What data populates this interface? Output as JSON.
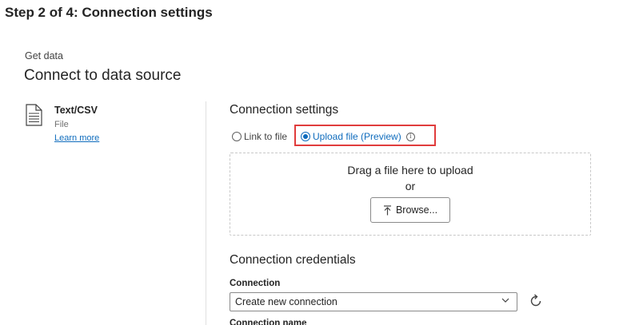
{
  "step_title": "Step 2 of 4: Connection settings",
  "breadcrumb": "Get data",
  "page_heading": "Connect to data source",
  "connector": {
    "name": "Text/CSV",
    "kind": "File",
    "learn_more": "Learn more",
    "icon": "file-document-icon"
  },
  "connection_settings": {
    "heading": "Connection settings",
    "options": [
      {
        "label": "Link to file",
        "selected": false
      },
      {
        "label": "Upload file (Preview)",
        "selected": true
      }
    ],
    "info_icon": "info-icon",
    "highlight_color": "#e03c3c",
    "dropzone": {
      "line1": "Drag a file here to upload",
      "line2": "or",
      "browse_label": "Browse...",
      "browse_icon": "upload-icon"
    }
  },
  "credentials": {
    "heading": "Connection credentials",
    "connection_label": "Connection",
    "connection_value": "Create new connection",
    "refresh_icon": "refresh-icon",
    "next_label": "Connection name"
  },
  "colors": {
    "accent": "#0f6cbd",
    "text": "#242424"
  }
}
